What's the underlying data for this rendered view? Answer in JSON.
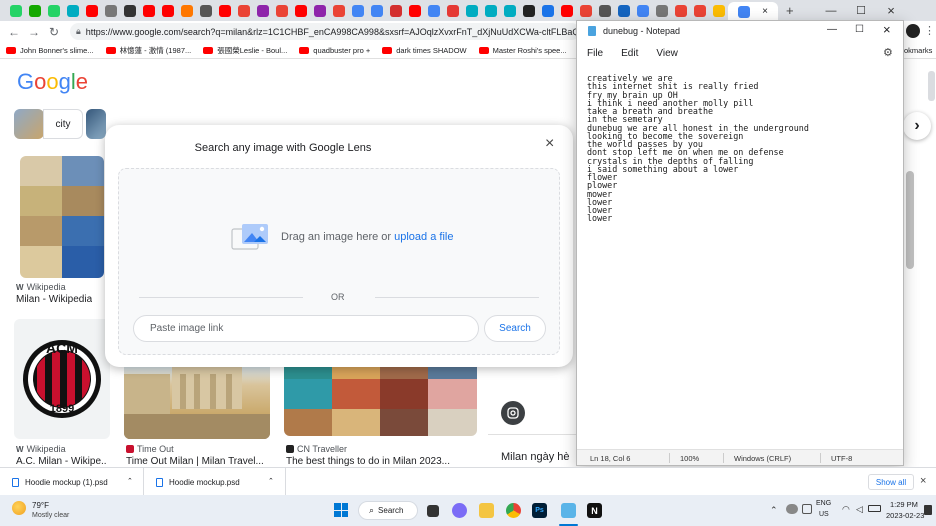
{
  "browser": {
    "tabs": {
      "icons": [
        {
          "name": "whatsapp-icon",
          "color": "#25d366"
        },
        {
          "name": "upwork-icon",
          "color": "#14a800"
        },
        {
          "name": "whatsapp-icon",
          "color": "#25d366"
        },
        {
          "name": "play-icon",
          "color": "#00acc1"
        },
        {
          "name": "youtube-icon",
          "color": "#ff0000"
        },
        {
          "name": "wikipedia-icon",
          "color": "#777777"
        },
        {
          "name": "generic-icon",
          "color": "#333333"
        },
        {
          "name": "youtube-icon",
          "color": "#ff0000"
        },
        {
          "name": "youtube-icon",
          "color": "#ff0000"
        },
        {
          "name": "soundcloud-icon",
          "color": "#ff7700"
        },
        {
          "name": "bag-icon",
          "color": "#555555"
        },
        {
          "name": "youtube-icon",
          "color": "#ff0000"
        },
        {
          "name": "gmail-icon",
          "color": "#ea4335"
        },
        {
          "name": "play-icon",
          "color": "#8e24aa"
        },
        {
          "name": "gmail-icon",
          "color": "#ea4335"
        },
        {
          "name": "youtube-icon",
          "color": "#ff0000"
        },
        {
          "name": "play-icon",
          "color": "#8e24aa"
        },
        {
          "name": "gmail-icon",
          "color": "#ea4335"
        },
        {
          "name": "google-icon",
          "color": "#4285f4"
        },
        {
          "name": "google-icon",
          "color": "#4285f4"
        },
        {
          "name": "generic-icon",
          "color": "#d32f2f"
        },
        {
          "name": "youtube-icon",
          "color": "#ff0000"
        },
        {
          "name": "google-icon",
          "color": "#4285f4"
        },
        {
          "name": "adobe-icon",
          "color": "#e53935"
        },
        {
          "name": "play-icon",
          "color": "#00acc1"
        },
        {
          "name": "play-icon",
          "color": "#00acc1"
        },
        {
          "name": "play-icon",
          "color": "#00acc1"
        },
        {
          "name": "generic-icon",
          "color": "#222222"
        },
        {
          "name": "shazam-icon",
          "color": "#1a73e8"
        },
        {
          "name": "youtube-icon",
          "color": "#ff0000"
        },
        {
          "name": "gmail-icon",
          "color": "#ea4335"
        },
        {
          "name": "download-icon",
          "color": "#555555"
        },
        {
          "name": "text-icon",
          "color": "#1565c0"
        },
        {
          "name": "google-icon",
          "color": "#4285f4"
        },
        {
          "name": "wikipedia-icon",
          "color": "#777777"
        },
        {
          "name": "gmail-icon",
          "color": "#ea4335"
        },
        {
          "name": "gmail-icon",
          "color": "#ea4335"
        },
        {
          "name": "drive-icon",
          "color": "#fbbc04"
        }
      ],
      "active_close": "×",
      "new_tab": "+"
    },
    "url": "https://www.google.com/search?q=milan&rlz=1C1CHBF_enCA998CA998&sxsrf=AJOqlzXvxrFnT_dXjNuUdXCWa-cltFLBaQ:1677174",
    "bookmarks": [
      "John Bonner's slime...",
      "林憶蓮 - 激情 (1987...",
      "張國榮Leslie - Boul...",
      "quadbuster pro +",
      "dark times SHADOW",
      "Master Roshi's spee...",
      "Bl"
    ],
    "bookmarks_right": "okmarks"
  },
  "google": {
    "logo": [
      "G",
      "o",
      "o",
      "g",
      "l",
      "e"
    ],
    "logo_colors": [
      "#4285f4",
      "#ea4335",
      "#fbbc05",
      "#4285f4",
      "#34a853",
      "#ea4335"
    ],
    "chip_label": "city",
    "results": [
      {
        "source": "Wikipedia",
        "title": "Milan - Wikipedia"
      },
      {
        "source": "Wikipedia",
        "title": "A.C. Milan - Wikipe..."
      },
      {
        "source": "Time Out",
        "title": "Time Out Milan | Milan Travel..."
      },
      {
        "source": "CN Traveller",
        "title": "The best things to do in Milan 2023..."
      }
    ],
    "right_title": "Milan ngày hè",
    "acm_text_top": "ACM",
    "acm_text_bottom": "1899"
  },
  "lens": {
    "title": "Search any image with Google Lens",
    "close": "×",
    "drag_text": "Drag an image here or",
    "upload_link": "upload a file",
    "or": "OR",
    "link_placeholder": "Paste image link",
    "search_button": "Search"
  },
  "notepad": {
    "title": "dunebug - Notepad",
    "menu": [
      "File",
      "Edit",
      "View"
    ],
    "text": "creatively we are\nthis internet shit is really fried\nfry my brain up OH\ni think i need another molly pill\ntake a breath and breathe\nin the semetary\ndunebug we are all honest in the underground\nlooking to become the sovereign\nthe world passes by you\ndont stop left me on when me on defense\ncrystals in the depths of falling\ni said something about a lower\nflower\nplower\nmower\nlower\nlower\nlower",
    "status": {
      "position": "Ln 18, Col 6",
      "zoom": "100%",
      "line_ending": "Windows (CRLF)",
      "encoding": "UTF-8"
    },
    "controls": {
      "minimize": "—",
      "maximize": "☐",
      "close": "×"
    }
  },
  "downloads": {
    "items": [
      "Hoodie mockup (1).psd",
      "Hoodie mockup.psd"
    ],
    "show_all": "Show all",
    "close": "×"
  },
  "taskbar": {
    "weather_temp": "79°F",
    "weather_desc": "Mostly clear",
    "search_label": "Search",
    "lang_top": "ENG",
    "lang_bottom": "US",
    "time": "1:29 PM",
    "date": "2023-02-23"
  }
}
